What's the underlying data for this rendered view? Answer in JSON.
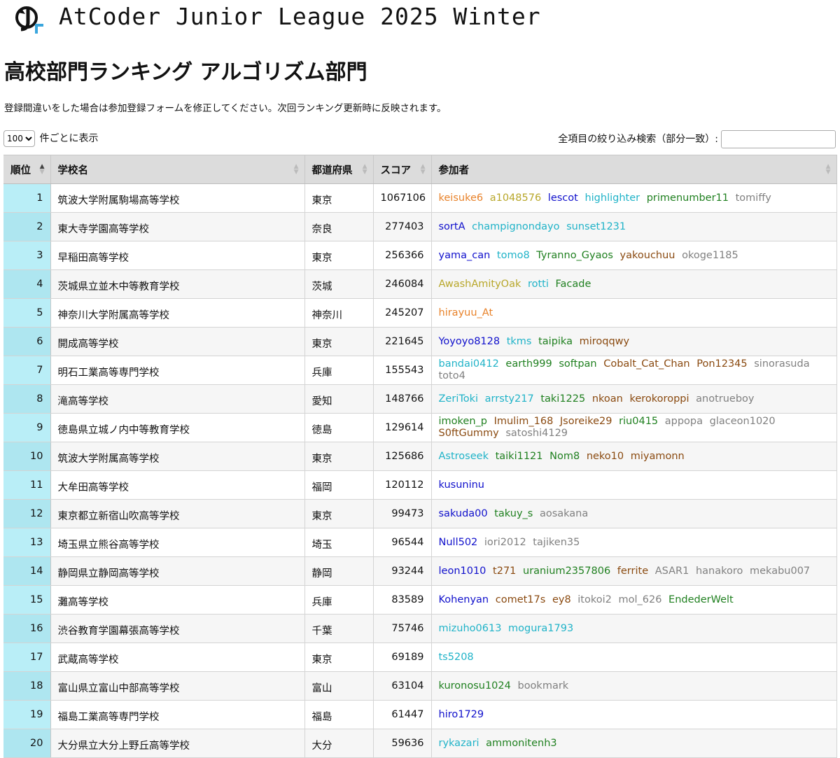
{
  "header": {
    "site_title": "AtCoder Junior League 2025 Winter"
  },
  "page": {
    "title": "高校部門ランキング アルゴリズム部門",
    "notice": "登録間違いをした場合は参加登録フォームを修正してください。次回ランキング更新時に反映されます。"
  },
  "controls": {
    "page_size": "100",
    "page_size_suffix": "件ごとに表示",
    "search_label": "全項目の絞り込み検索（部分一致）:",
    "search_value": ""
  },
  "colors": {
    "orange": "#e8822a",
    "yellow": "#b8a72a",
    "blue": "#1010cc",
    "cyan": "#20b3c8",
    "green": "#208020",
    "brown": "#8a4a10",
    "gray": "#808080"
  },
  "table": {
    "columns": [
      "順位",
      "学校名",
      "都道府県",
      "スコア",
      "参加者"
    ],
    "rows": [
      {
        "rank": "1",
        "school": "筑波大学附属駒場高等学校",
        "pref": "東京",
        "score": "1067106",
        "members": [
          {
            "name": "keisuke6",
            "color": "orange"
          },
          {
            "name": "a1048576",
            "color": "yellow"
          },
          {
            "name": "lescot",
            "color": "blue"
          },
          {
            "name": "highlighter",
            "color": "cyan"
          },
          {
            "name": "primenumber11",
            "color": "green"
          },
          {
            "name": "tomiffy",
            "color": "gray"
          }
        ]
      },
      {
        "rank": "2",
        "school": "東大寺学園高等学校",
        "pref": "奈良",
        "score": "277403",
        "members": [
          {
            "name": "sortA",
            "color": "blue"
          },
          {
            "name": "champignondayo",
            "color": "cyan"
          },
          {
            "name": "sunset1231",
            "color": "cyan"
          }
        ]
      },
      {
        "rank": "3",
        "school": "早稲田高等学校",
        "pref": "東京",
        "score": "256366",
        "members": [
          {
            "name": "yama_can",
            "color": "blue"
          },
          {
            "name": "tomo8",
            "color": "cyan"
          },
          {
            "name": "Tyranno_Gyaos",
            "color": "green"
          },
          {
            "name": "yakouchuu",
            "color": "brown"
          },
          {
            "name": "okoge1185",
            "color": "gray"
          }
        ]
      },
      {
        "rank": "4",
        "school": "茨城県立並木中等教育学校",
        "pref": "茨城",
        "score": "246084",
        "members": [
          {
            "name": "AwashAmityOak",
            "color": "yellow"
          },
          {
            "name": "rotti",
            "color": "cyan"
          },
          {
            "name": "Facade",
            "color": "green"
          }
        ]
      },
      {
        "rank": "5",
        "school": "神奈川大学附属高等学校",
        "pref": "神奈川",
        "score": "245207",
        "members": [
          {
            "name": "hirayuu_At",
            "color": "orange"
          }
        ]
      },
      {
        "rank": "6",
        "school": "開成高等学校",
        "pref": "東京",
        "score": "221645",
        "members": [
          {
            "name": "Yoyoyo8128",
            "color": "blue"
          },
          {
            "name": "tkms",
            "color": "cyan"
          },
          {
            "name": "taipika",
            "color": "green"
          },
          {
            "name": "miroqqwy",
            "color": "brown"
          }
        ]
      },
      {
        "rank": "7",
        "school": "明石工業高等専門学校",
        "pref": "兵庫",
        "score": "155543",
        "members": [
          {
            "name": "bandai0412",
            "color": "cyan"
          },
          {
            "name": "earth999",
            "color": "green"
          },
          {
            "name": "softpan",
            "color": "green"
          },
          {
            "name": "Cobalt_Cat_Chan",
            "color": "brown"
          },
          {
            "name": "Pon12345",
            "color": "brown"
          },
          {
            "name": "sinorasuda",
            "color": "gray"
          },
          {
            "name": "toto4",
            "color": "gray"
          }
        ]
      },
      {
        "rank": "8",
        "school": "滝高等学校",
        "pref": "愛知",
        "score": "148766",
        "members": [
          {
            "name": "ZeriToki",
            "color": "cyan"
          },
          {
            "name": "arrsty217",
            "color": "cyan"
          },
          {
            "name": "taki1225",
            "color": "green"
          },
          {
            "name": "nkoan",
            "color": "brown"
          },
          {
            "name": "kerokoroppi",
            "color": "brown"
          },
          {
            "name": "anotrueboy",
            "color": "gray"
          }
        ]
      },
      {
        "rank": "9",
        "school": "徳島県立城ノ内中等教育学校",
        "pref": "徳島",
        "score": "129614",
        "members": [
          {
            "name": "imoken_p",
            "color": "green"
          },
          {
            "name": "Imulim_168",
            "color": "brown"
          },
          {
            "name": "Jsoreike29",
            "color": "brown"
          },
          {
            "name": "riu0415",
            "color": "green"
          },
          {
            "name": "appopa",
            "color": "gray"
          },
          {
            "name": "glaceon1020",
            "color": "gray"
          },
          {
            "name": "S0ftGummy",
            "color": "brown"
          },
          {
            "name": "satoshi4129",
            "color": "gray"
          }
        ]
      },
      {
        "rank": "10",
        "school": "筑波大学附属高等学校",
        "pref": "東京",
        "score": "125686",
        "members": [
          {
            "name": "Astroseek",
            "color": "cyan"
          },
          {
            "name": "taiki1121",
            "color": "green"
          },
          {
            "name": "Nom8",
            "color": "green"
          },
          {
            "name": "neko10",
            "color": "brown"
          },
          {
            "name": "miyamonn",
            "color": "brown"
          }
        ]
      },
      {
        "rank": "11",
        "school": "大牟田高等学校",
        "pref": "福岡",
        "score": "120112",
        "members": [
          {
            "name": "kusuninu",
            "color": "blue"
          }
        ]
      },
      {
        "rank": "12",
        "school": "東京都立新宿山吹高等学校",
        "pref": "東京",
        "score": "99473",
        "members": [
          {
            "name": "sakuda00",
            "color": "blue"
          },
          {
            "name": "takuy_s",
            "color": "green"
          },
          {
            "name": "aosakana",
            "color": "gray"
          }
        ]
      },
      {
        "rank": "13",
        "school": "埼玉県立熊谷高等学校",
        "pref": "埼玉",
        "score": "96544",
        "members": [
          {
            "name": "Null502",
            "color": "blue"
          },
          {
            "name": "iori2012",
            "color": "gray"
          },
          {
            "name": "tajiken35",
            "color": "gray"
          }
        ]
      },
      {
        "rank": "14",
        "school": "静岡県立静岡高等学校",
        "pref": "静岡",
        "score": "93244",
        "members": [
          {
            "name": "leon1010",
            "color": "blue"
          },
          {
            "name": "t271",
            "color": "brown"
          },
          {
            "name": "uranium2357806",
            "color": "green"
          },
          {
            "name": "ferrite",
            "color": "brown"
          },
          {
            "name": "ASAR1",
            "color": "gray"
          },
          {
            "name": "hanakoro",
            "color": "gray"
          },
          {
            "name": "mekabu007",
            "color": "gray"
          }
        ]
      },
      {
        "rank": "15",
        "school": "灘高等学校",
        "pref": "兵庫",
        "score": "83589",
        "members": [
          {
            "name": "Kohenyan",
            "color": "blue"
          },
          {
            "name": "comet17s",
            "color": "brown"
          },
          {
            "name": "ey8",
            "color": "brown"
          },
          {
            "name": "itokoi2",
            "color": "gray"
          },
          {
            "name": "mol_626",
            "color": "gray"
          },
          {
            "name": "EndederWelt",
            "color": "green"
          }
        ]
      },
      {
        "rank": "16",
        "school": "渋谷教育学園幕張高等学校",
        "pref": "千葉",
        "score": "75746",
        "members": [
          {
            "name": "mizuho0613",
            "color": "cyan"
          },
          {
            "name": "mogura1793",
            "color": "cyan"
          }
        ]
      },
      {
        "rank": "17",
        "school": "武蔵高等学校",
        "pref": "東京",
        "score": "69189",
        "members": [
          {
            "name": "ts5208",
            "color": "cyan"
          }
        ]
      },
      {
        "rank": "18",
        "school": "富山県立富山中部高等学校",
        "pref": "富山",
        "score": "63104",
        "members": [
          {
            "name": "kuronosu1024",
            "color": "green"
          },
          {
            "name": "bookmark",
            "color": "gray"
          }
        ]
      },
      {
        "rank": "19",
        "school": "福島工業高等専門学校",
        "pref": "福島",
        "score": "61447",
        "members": [
          {
            "name": "hiro1729",
            "color": "blue"
          }
        ]
      },
      {
        "rank": "20",
        "school": "大分県立大分上野丘高等学校",
        "pref": "大分",
        "score": "59636",
        "members": [
          {
            "name": "rykazari",
            "color": "cyan"
          },
          {
            "name": "ammonitenh3",
            "color": "green"
          }
        ]
      }
    ]
  }
}
